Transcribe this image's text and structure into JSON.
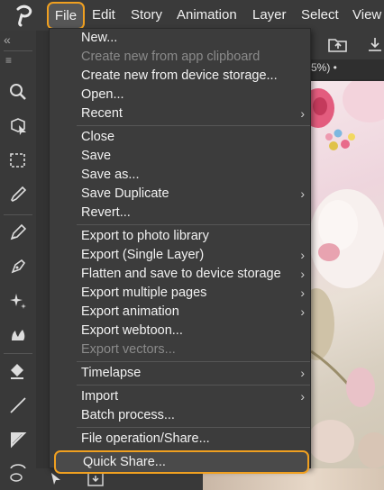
{
  "menubar": {
    "items": [
      "File",
      "Edit",
      "Story",
      "Animation",
      "Layer",
      "Select",
      "View"
    ]
  },
  "zoom_display": "5%) •",
  "file_menu": {
    "groups": [
      [
        {
          "label": "New...",
          "enabled": true,
          "submenu": false
        },
        {
          "label": "Create new from app clipboard",
          "enabled": false,
          "submenu": false
        },
        {
          "label": "Create new from device storage...",
          "enabled": true,
          "submenu": false
        },
        {
          "label": "Open...",
          "enabled": true,
          "submenu": false
        },
        {
          "label": "Recent",
          "enabled": true,
          "submenu": true
        }
      ],
      [
        {
          "label": "Close",
          "enabled": true,
          "submenu": false
        },
        {
          "label": "Save",
          "enabled": true,
          "submenu": false
        },
        {
          "label": "Save as...",
          "enabled": true,
          "submenu": false
        },
        {
          "label": "Save Duplicate",
          "enabled": true,
          "submenu": true
        },
        {
          "label": "Revert...",
          "enabled": true,
          "submenu": false
        }
      ],
      [
        {
          "label": "Export to photo library",
          "enabled": true,
          "submenu": false
        },
        {
          "label": "Export (Single Layer)",
          "enabled": true,
          "submenu": true
        },
        {
          "label": "Flatten and save to device storage",
          "enabled": true,
          "submenu": true
        },
        {
          "label": "Export multiple pages",
          "enabled": true,
          "submenu": true
        },
        {
          "label": "Export animation",
          "enabled": true,
          "submenu": true
        },
        {
          "label": "Export webtoon...",
          "enabled": true,
          "submenu": false
        },
        {
          "label": "Export vectors...",
          "enabled": false,
          "submenu": false
        }
      ],
      [
        {
          "label": "Timelapse",
          "enabled": true,
          "submenu": true
        }
      ],
      [
        {
          "label": "Import",
          "enabled": true,
          "submenu": true
        },
        {
          "label": "Batch process...",
          "enabled": true,
          "submenu": false
        }
      ],
      [
        {
          "label": "File operation/Share...",
          "enabled": true,
          "submenu": false
        },
        {
          "label": "Quick Share...",
          "enabled": true,
          "submenu": false,
          "highlighted": true
        }
      ]
    ]
  },
  "colors": {
    "highlight": "#f0a020",
    "menu_bg": "#3c3c3c",
    "text": "#f2f2f2",
    "disabled_text": "#8a8a8a"
  },
  "icons": {
    "app_logo": "clip-studio-logo-icon",
    "tools": [
      "zoom-icon",
      "object-select-icon",
      "marquee-select-icon",
      "eyedropper-icon",
      "pen-icon",
      "pencil-icon",
      "sparkle-brush-icon",
      "blend-icon",
      "fill-bucket-icon",
      "line-icon",
      "shape-icon",
      "lasso-icon"
    ]
  }
}
